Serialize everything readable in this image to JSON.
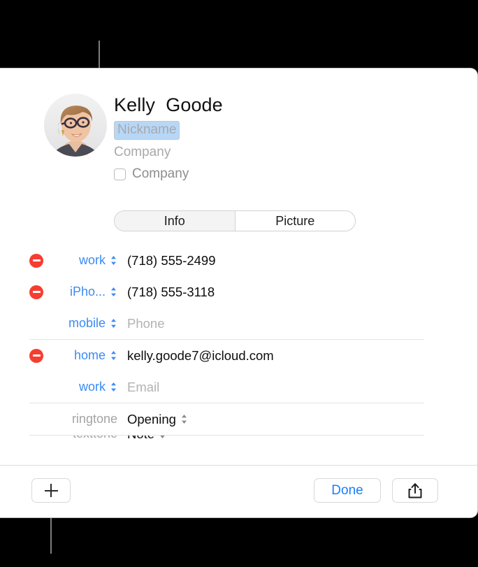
{
  "annotation": {
    "top_leader_line": "leader-line-to-nickname",
    "bottom_leader_line": "leader-line-to-add-button"
  },
  "header": {
    "avatar_alt": "contact-photo",
    "full_name": "Kelly  Goode",
    "nickname_placeholder": "Nickname",
    "company_placeholder": "Company",
    "company_checkbox_label": "Company",
    "company_checkbox_checked": false
  },
  "segmented_control": {
    "selected": "Info",
    "options": [
      {
        "label": "Info",
        "selected": true
      },
      {
        "label": "Picture",
        "selected": false
      }
    ]
  },
  "fields": [
    {
      "type": "phone",
      "has_remove": true,
      "label": "work",
      "label_muted": false,
      "value": "(718) 555-2499",
      "is_placeholder": false
    },
    {
      "type": "phone",
      "has_remove": true,
      "label": "iPho...",
      "label_muted": false,
      "value": "(718) 555-3118",
      "is_placeholder": false
    },
    {
      "type": "phone",
      "has_remove": false,
      "label": "mobile",
      "label_muted": false,
      "value": "Phone",
      "is_placeholder": true
    },
    {
      "type": "email",
      "has_remove": true,
      "label": "home",
      "label_muted": false,
      "value": "kelly.goode7@icloud.com",
      "is_placeholder": false
    },
    {
      "type": "email",
      "has_remove": false,
      "label": "work",
      "label_muted": false,
      "value": "Email",
      "is_placeholder": true
    },
    {
      "type": "ringtone",
      "has_remove": false,
      "label": "ringtone",
      "label_muted": true,
      "value": "Opening",
      "is_placeholder": false,
      "value_has_stepper": true
    },
    {
      "type": "texttone",
      "has_remove": false,
      "label": "texttone",
      "label_muted": true,
      "value": "Note",
      "is_placeholder": false,
      "value_has_stepper": true,
      "clipped": true
    }
  ],
  "toolbar": {
    "add_label": "add-button",
    "done_label": "Done",
    "share_label": "share-button"
  },
  "colors": {
    "accent_blue": "#1b7ef7",
    "label_blue": "#3b8bf5",
    "remove_red": "#f63d30",
    "selection_blue": "#b7d7f7",
    "placeholder_gray": "#b2b2b5"
  }
}
